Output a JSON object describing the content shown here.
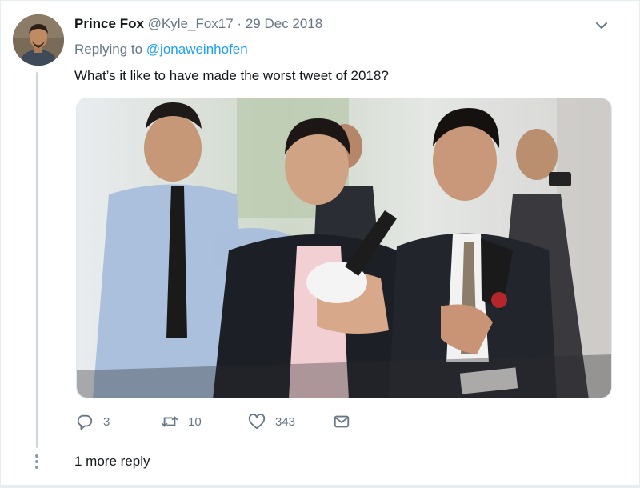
{
  "tweet": {
    "display_name": "Prince Fox",
    "handle": "@Kyle_Fox17",
    "separator": "·",
    "date": "29 Dec 2018",
    "replying_prefix": "Replying to",
    "replying_to": "@jonaweinhofen",
    "text": "What’s it like to have made the worst tweet of 2018?",
    "media_alt": "Group of reporters in business attire holding out microphones"
  },
  "actions": {
    "replies": "3",
    "retweets": "10",
    "likes": "343"
  },
  "thread": {
    "more_replies": "1 more reply"
  },
  "icons": {
    "caret": "chevron-down-icon",
    "reply": "reply-icon",
    "retweet": "retweet-icon",
    "like": "heart-icon",
    "dm": "envelope-icon"
  },
  "colors": {
    "link": "#1da1f2",
    "secondary_text": "#657786",
    "primary_text": "#14171a",
    "thread_line": "#ccd6dd"
  }
}
